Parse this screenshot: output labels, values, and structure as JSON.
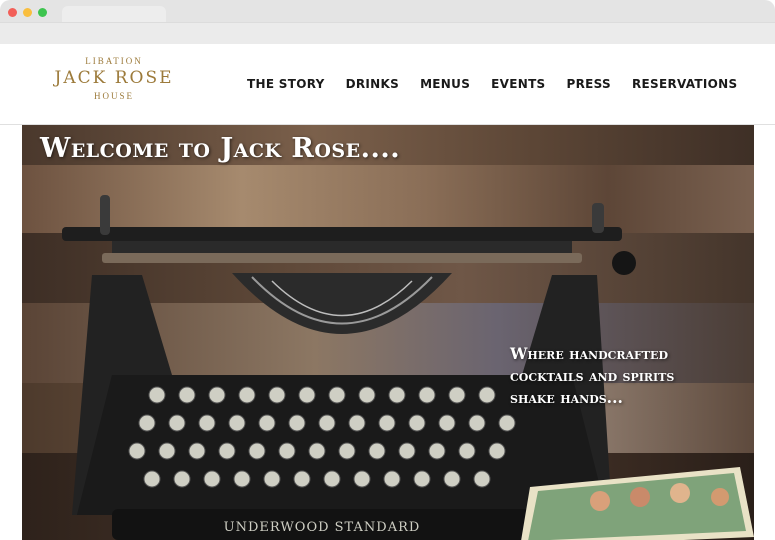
{
  "site": {
    "logo_top": "LIBATION",
    "logo_main": "JACK ROSE",
    "logo_bottom": "HOUSE"
  },
  "nav": {
    "items": [
      {
        "label": "THE STORY"
      },
      {
        "label": "DRINKS"
      },
      {
        "label": "MENUS"
      },
      {
        "label": "EVENTS"
      },
      {
        "label": "PRESS"
      },
      {
        "label": "RESERVATIONS"
      }
    ]
  },
  "hero": {
    "title": "Welcome to Jack Rose....",
    "tagline_lines": [
      "Where handcrafted",
      "cocktails and spirits",
      "shake hands..."
    ],
    "typewriter_text": "UNDERWOOD STANDARD"
  },
  "colors": {
    "brand_gold": "#9c7a3a",
    "nav_text": "#1a1a1a",
    "hero_text": "#ffffff"
  }
}
